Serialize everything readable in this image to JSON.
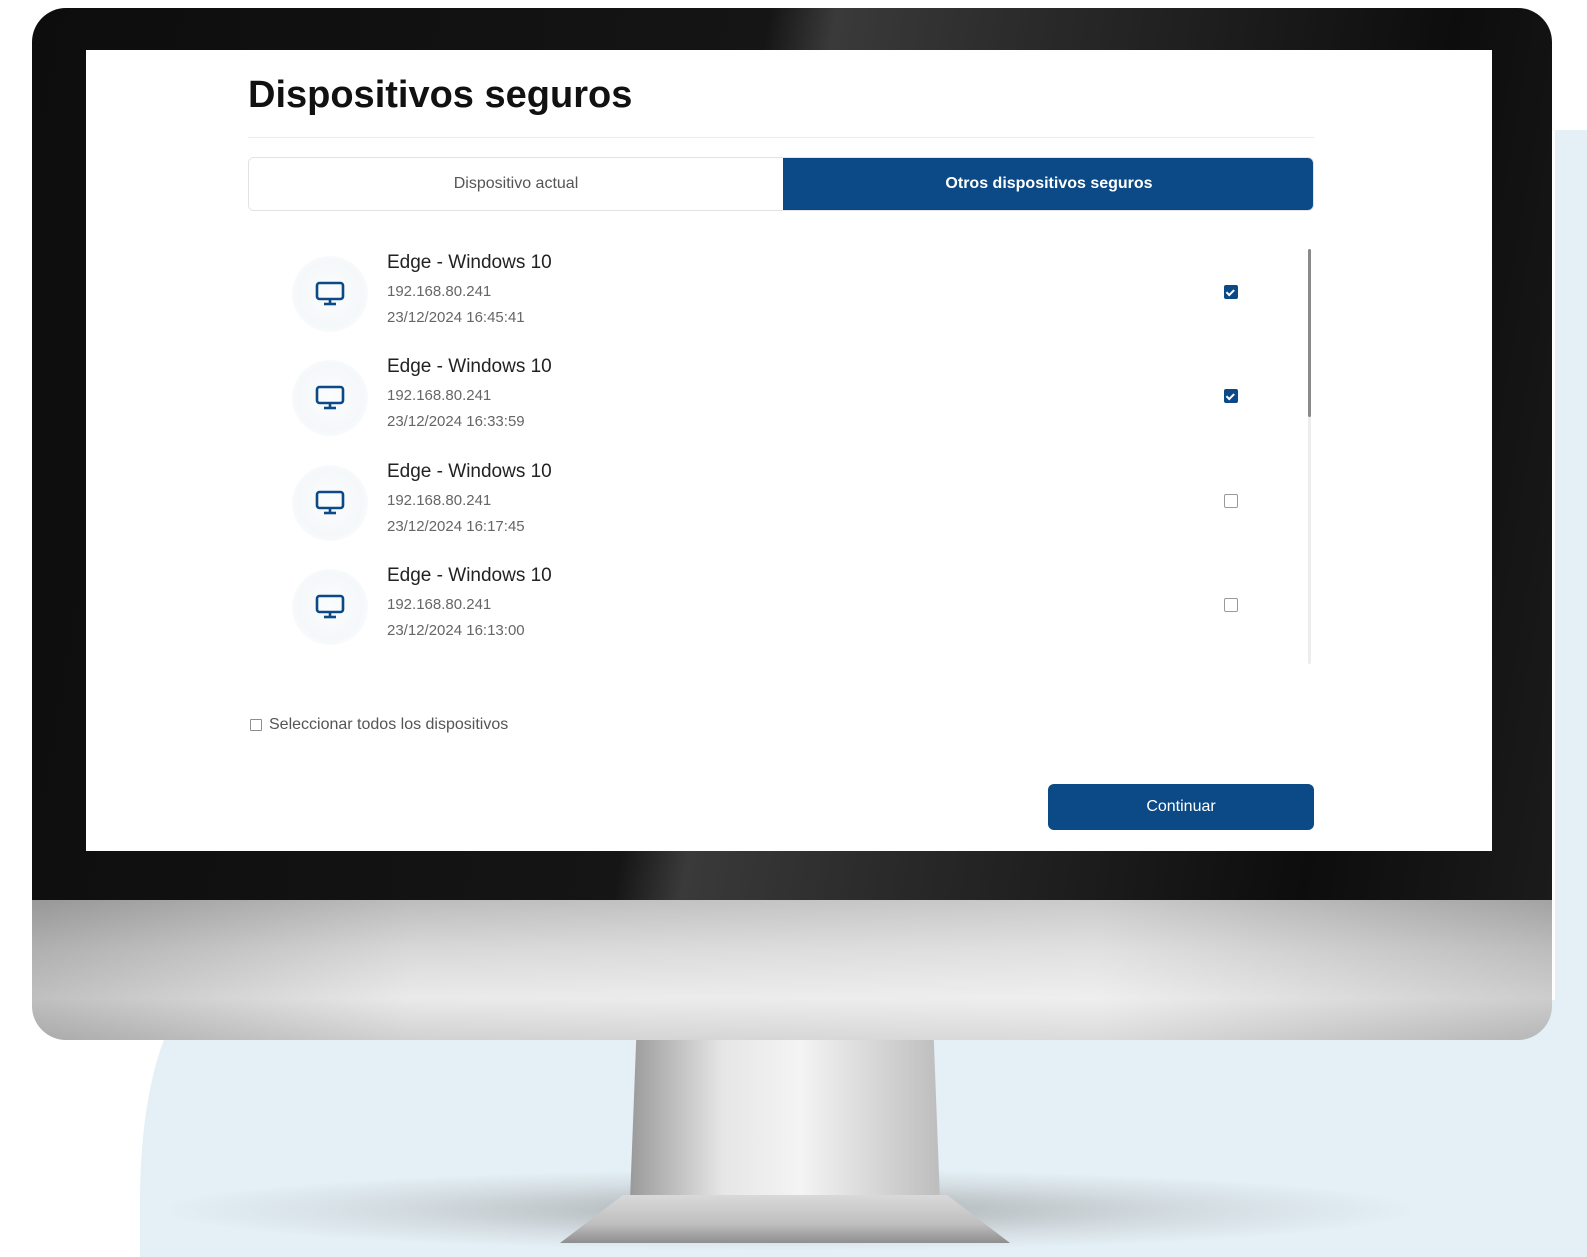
{
  "page": {
    "title": "Dispositivos seguros"
  },
  "tabs": [
    {
      "label": "Dispositivo actual",
      "active": false
    },
    {
      "label": "Otros dispositivos seguros",
      "active": true
    }
  ],
  "devices": [
    {
      "name": "Edge - Windows 10",
      "ip": "192.168.80.241",
      "date": "23/12/2024 16:45:41",
      "checked": true,
      "icon": "monitor-icon"
    },
    {
      "name": "Edge - Windows 10",
      "ip": "192.168.80.241",
      "date": "23/12/2024 16:33:59",
      "checked": true,
      "icon": "monitor-icon"
    },
    {
      "name": "Edge - Windows 10",
      "ip": "192.168.80.241",
      "date": "23/12/2024 16:17:45",
      "checked": false,
      "icon": "monitor-icon"
    },
    {
      "name": "Edge - Windows 10",
      "ip": "192.168.80.241",
      "date": "23/12/2024 16:13:00",
      "checked": false,
      "icon": "monitor-icon"
    }
  ],
  "select_all": {
    "label": "Seleccionar todos los dispositivos",
    "checked": false
  },
  "actions": {
    "continue_label": "Continuar"
  },
  "colors": {
    "accent": "#0b4a86",
    "background_shape": "#e4f0f6"
  }
}
